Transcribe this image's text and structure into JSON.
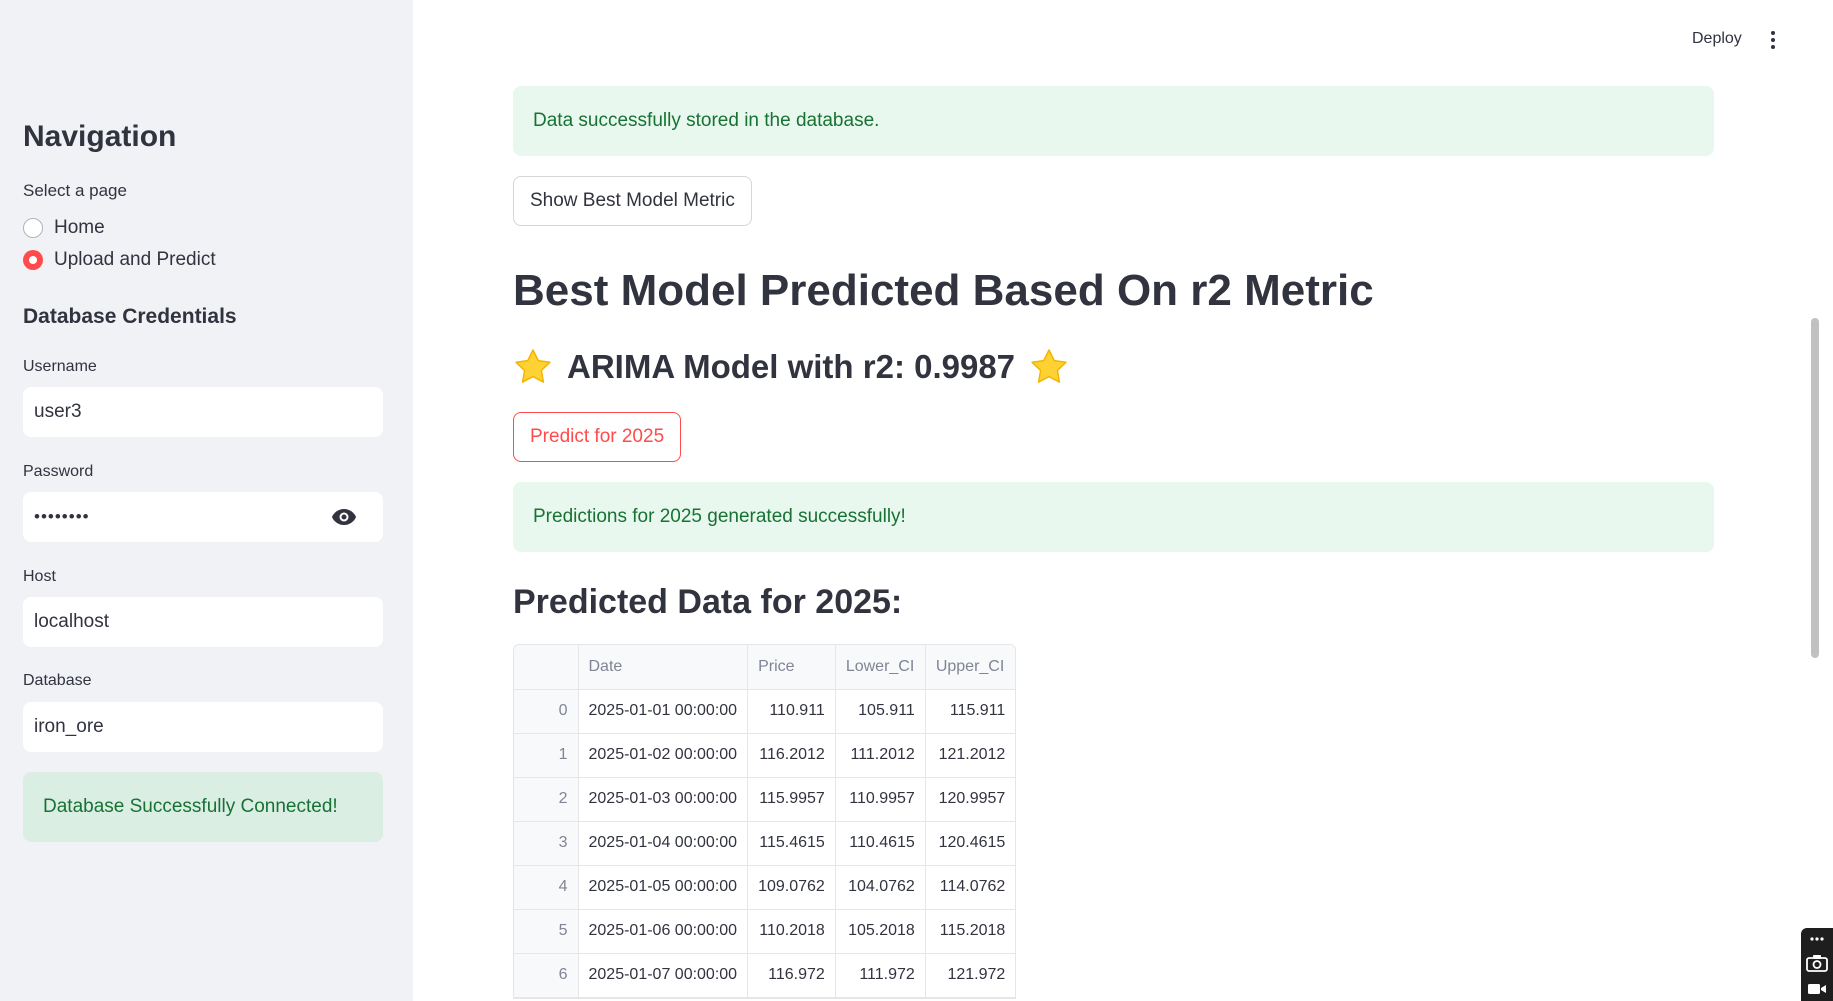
{
  "sidebar": {
    "nav_title": "Navigation",
    "select_label": "Select a page",
    "pages": [
      {
        "label": "Home",
        "selected": false
      },
      {
        "label": "Upload and Predict",
        "selected": true
      }
    ],
    "credentials_title": "Database Credentials",
    "username": {
      "label": "Username",
      "value": "user3"
    },
    "password": {
      "label": "Password",
      "value": "••••••••"
    },
    "host": {
      "label": "Host",
      "value": "localhost"
    },
    "database": {
      "label": "Database",
      "value": "iron_ore"
    },
    "connected_alert": "Database Successfully Connected!"
  },
  "header": {
    "deploy_label": "Deploy",
    "menu_icon": "kebab-menu-icon"
  },
  "main": {
    "stored_alert": "Data successfully stored in the database.",
    "show_metric_button": "Show Best Model Metric",
    "best_model_heading": "Best Model Predicted Based On r2 Metric",
    "model_result": "ARIMA Model with r2: 0.9987",
    "predict_button": "Predict for 2025",
    "predictions_alert": "Predictions for 2025 generated successfully!",
    "predicted_heading": "Predicted Data for 2025:",
    "table": {
      "columns": [
        "",
        "Date",
        "Price",
        "Lower_CI",
        "Upper_CI"
      ],
      "rows": [
        [
          "0",
          "2025-01-01 00:00:00",
          "110.911",
          "105.911",
          "115.911"
        ],
        [
          "1",
          "2025-01-02 00:00:00",
          "116.2012",
          "111.2012",
          "121.2012"
        ],
        [
          "2",
          "2025-01-03 00:00:00",
          "115.9957",
          "110.9957",
          "120.9957"
        ],
        [
          "3",
          "2025-01-04 00:00:00",
          "115.4615",
          "110.4615",
          "120.4615"
        ],
        [
          "4",
          "2025-01-05 00:00:00",
          "109.0762",
          "104.0762",
          "114.0762"
        ],
        [
          "5",
          "2025-01-06 00:00:00",
          "110.2018",
          "105.2018",
          "115.2018"
        ],
        [
          "6",
          "2025-01-07 00:00:00",
          "116.972",
          "111.972",
          "121.972"
        ]
      ]
    }
  },
  "colors": {
    "accent": "#ff4b4b",
    "success_text": "#177233",
    "success_bg": "#e8f8ee",
    "sidebar_bg": "#f0f2f6"
  }
}
